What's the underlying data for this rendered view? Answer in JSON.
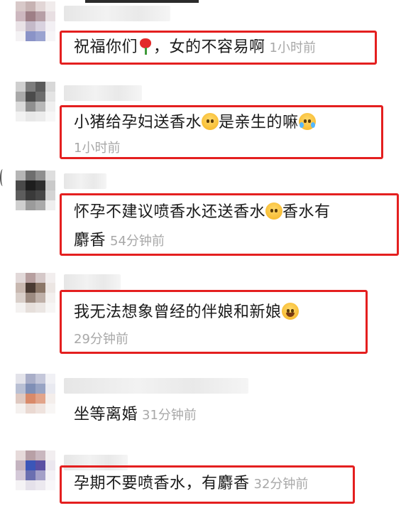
{
  "comments": [
    {
      "text": "祝福你们",
      "emoji": "rose-emoji",
      "text2": "，女的不容易啊",
      "time": "1小时前"
    },
    {
      "text": "小猪给孕妇送香水",
      "emoji": "thinking-face-emoji",
      "text2": "是亲生的嘛",
      "emoji2": "crying-face-emoji",
      "time": "1小时前"
    },
    {
      "line1": "怀孕不建议喷香水还送香水",
      "emoji": "thinking-face-emoji",
      "line1b": "香水有",
      "line2": "麝香",
      "time": "54分钟前"
    },
    {
      "text": "我无法想象曾经的伴娘和新娘",
      "emoji": "laughing-face-emoji",
      "time": "29分钟前"
    },
    {
      "text": "坐等离婚",
      "time": "31分钟前"
    },
    {
      "text": "孕期不要喷香水，有麝香",
      "time": "32分钟前"
    }
  ],
  "colors": {
    "highlight_border": "#e41f1f",
    "timestamp": "#a8a8a8",
    "text": "#1a1a1a"
  }
}
